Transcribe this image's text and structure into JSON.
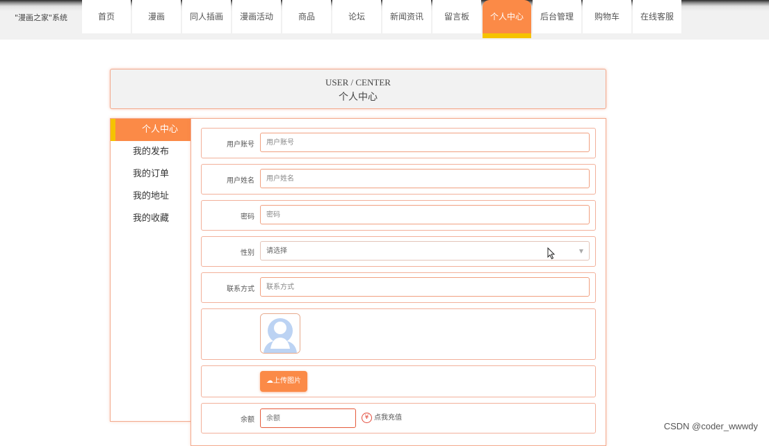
{
  "brand": "\"漫画之家\"系统",
  "nav": {
    "items": [
      "首页",
      "漫画",
      "同人插画",
      "漫画活动",
      "商品",
      "论坛",
      "新闻资讯",
      "留言板",
      "个人中心",
      "后台管理",
      "购物车",
      "在线客服"
    ],
    "active": "个人中心"
  },
  "title": {
    "en": "USER / CENTER",
    "cn": "个人中心"
  },
  "sidebar": {
    "items": [
      {
        "label": "个人中心",
        "active": true
      },
      {
        "label": "我的发布",
        "active": false
      },
      {
        "label": "我的订单",
        "active": false
      },
      {
        "label": "我的地址",
        "active": false
      },
      {
        "label": "我的收藏",
        "active": false
      }
    ]
  },
  "form": {
    "account": {
      "label": "用户账号",
      "placeholder": "用户账号"
    },
    "name": {
      "label": "用户姓名",
      "placeholder": "用户姓名"
    },
    "password": {
      "label": "密码",
      "placeholder": "密码"
    },
    "gender": {
      "label": "性别",
      "placeholder": "请选择"
    },
    "contact": {
      "label": "联系方式",
      "placeholder": "联系方式"
    },
    "upload_label": "上传图片",
    "balance": {
      "label": "余额",
      "placeholder": "余额"
    },
    "recharge_label": "点我充值"
  },
  "watermark": "CSDN @coder_wwwdy",
  "colors": {
    "accent": "#fb8a47",
    "highlight": "#f5c300",
    "border": "#f3a98c"
  }
}
